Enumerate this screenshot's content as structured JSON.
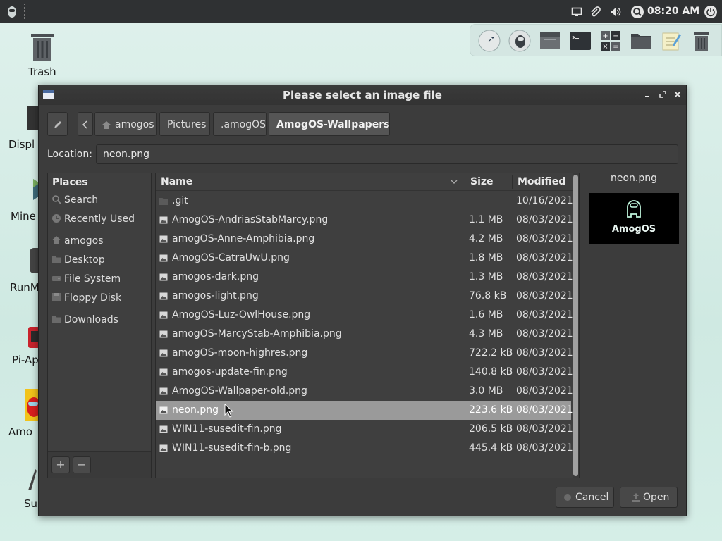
{
  "top_panel": {
    "clock": "08:20 AM",
    "icons": [
      "app-menu-icon",
      "display-icon",
      "paperclip-icon",
      "volume-icon",
      "search-icon",
      "power-icon"
    ]
  },
  "dock": {
    "items": [
      "rocket-icon",
      "amogos-icon",
      "window-icon",
      "terminal-icon",
      "calculator-icon",
      "folder-icon",
      "notes-icon",
      "trash-icon"
    ]
  },
  "desktop": {
    "items": [
      {
        "label": "Trash"
      },
      {
        "label": "Displ"
      },
      {
        "label": "Mine"
      },
      {
        "label": "RunM"
      },
      {
        "label": "Pi-Ap"
      },
      {
        "label": "Amo"
      },
      {
        "label": "Su"
      }
    ]
  },
  "dialog": {
    "title": "Please select an image file",
    "path": [
      "amogos",
      "Pictures",
      ".amogOS",
      "AmogOS-Wallpapers"
    ],
    "location_label": "Location:",
    "location_value": "neon.png",
    "places_header": "Places",
    "places": [
      "Search",
      "Recently Used",
      "amogos",
      "Desktop",
      "File System",
      "Floppy Disk",
      "Downloads"
    ],
    "columns": {
      "name": "Name",
      "size": "Size",
      "modified": "Modified"
    },
    "files": [
      {
        "name": ".git",
        "size": "",
        "modified": "10/16/2021",
        "kind": "folder"
      },
      {
        "name": "AmogOS-AndriasStabMarcy.png",
        "size": "1.1 MB",
        "modified": "08/03/2021",
        "kind": "image"
      },
      {
        "name": "amogOS-Anne-Amphibia.png",
        "size": "4.2 MB",
        "modified": "08/03/2021",
        "kind": "image"
      },
      {
        "name": "AmogOS-CatraUwU.png",
        "size": "1.8 MB",
        "modified": "08/03/2021",
        "kind": "image"
      },
      {
        "name": "amogos-dark.png",
        "size": "1.3 MB",
        "modified": "08/03/2021",
        "kind": "image"
      },
      {
        "name": "amogos-light.png",
        "size": "76.8 kB",
        "modified": "08/03/2021",
        "kind": "image"
      },
      {
        "name": "AmogOS-Luz-OwlHouse.png",
        "size": "1.6 MB",
        "modified": "08/03/2021",
        "kind": "image"
      },
      {
        "name": "amogOS-MarcyStab-Amphibia.png",
        "size": "4.3 MB",
        "modified": "08/03/2021",
        "kind": "image"
      },
      {
        "name": "amogOS-moon-highres.png",
        "size": "722.2 kB",
        "modified": "08/03/2021",
        "kind": "image"
      },
      {
        "name": "amogos-update-fin.png",
        "size": "140.8 kB",
        "modified": "08/03/2021",
        "kind": "image"
      },
      {
        "name": "AmogOS-Wallpaper-old.png",
        "size": "3.0 MB",
        "modified": "08/03/2021",
        "kind": "image"
      },
      {
        "name": "neon.png",
        "size": "223.6 kB",
        "modified": "08/03/2021",
        "kind": "image"
      },
      {
        "name": "WIN11-susedit-fin.png",
        "size": "206.5 kB",
        "modified": "08/03/2021",
        "kind": "image"
      },
      {
        "name": "WIN11-susedit-fin-b.png",
        "size": "445.4 kB",
        "modified": "08/03/2021",
        "kind": "image"
      }
    ],
    "selected_file": "neon.png",
    "preview_name": "neon.png",
    "preview_logo_text": "AmogOS",
    "cancel_label": "Cancel",
    "open_label": "Open"
  },
  "colors": {
    "panel": "#2f3133",
    "dialog_bg": "#3c3c3c",
    "selection": "#9a9a9a",
    "desktop_bg": "#d5eee7"
  }
}
